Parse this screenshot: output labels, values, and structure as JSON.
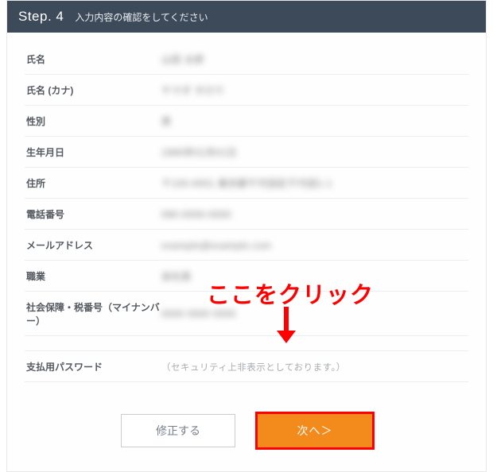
{
  "header": {
    "step_label": "Step. 4",
    "step_desc": "入力内容の確認をしてください"
  },
  "rows": {
    "name": {
      "label": "氏名",
      "value": "山田 太郎"
    },
    "name_kana": {
      "label": "氏名 (カナ)",
      "value": "ヤマダ タロウ"
    },
    "gender": {
      "label": "性別",
      "value": "男"
    },
    "birth": {
      "label": "生年月日",
      "value": "1990年01月01日"
    },
    "address": {
      "label": "住所",
      "value": "〒100-0001 東京都千代田区千代田1-1"
    },
    "phone": {
      "label": "電話番号",
      "value": "090-0000-0000"
    },
    "email": {
      "label": "メールアドレス",
      "value": "example@example.com"
    },
    "occupation": {
      "label": "職業",
      "value": "会社員"
    },
    "mynumber": {
      "label": "社会保障・税番号（マイナンバー）",
      "value": "0000 0000 0000"
    },
    "password": {
      "label": "支払用パスワード",
      "value": "（セキュリティ上非表示としております。）"
    }
  },
  "buttons": {
    "edit": "修正する",
    "next": "次へ＞"
  },
  "annotation": {
    "text": "ここをクリック"
  }
}
